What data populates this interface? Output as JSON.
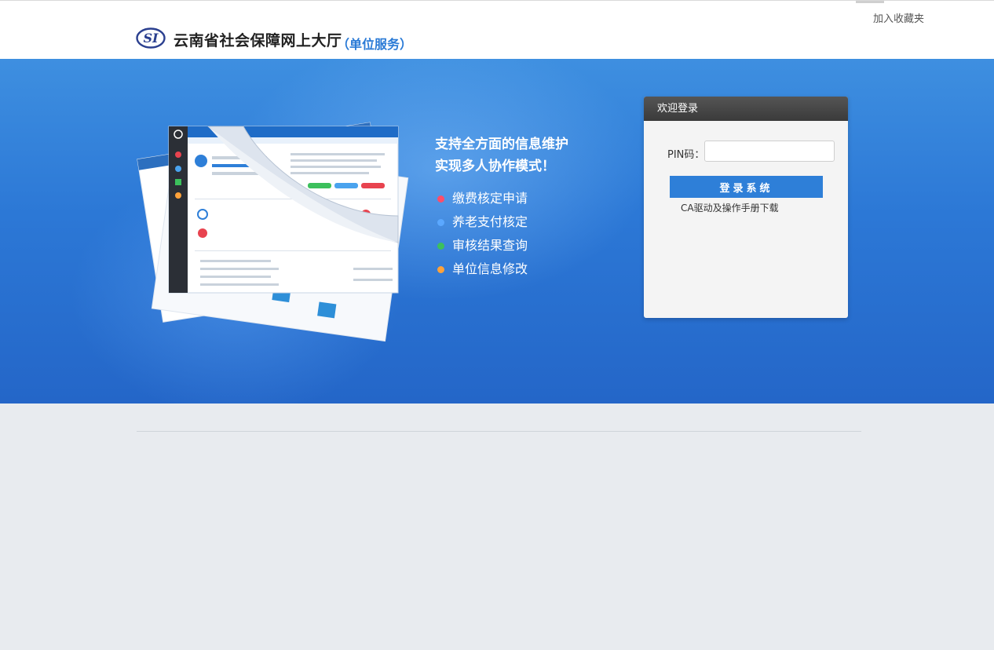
{
  "header": {
    "favorite": "加入收藏夹",
    "title": "云南省社会保障网上大厅",
    "subtitle": "（单位服务）",
    "logo_icon": "si-logo-icon"
  },
  "banner": {
    "slogan_line1": "支持全方面的信息维护",
    "slogan_line2": "实现多人协作模式！",
    "features": [
      {
        "label": "缴费核定申请",
        "color": "#ff4d6a"
      },
      {
        "label": "养老支付核定",
        "color": "#5ba8ff"
      },
      {
        "label": "审核结果查询",
        "color": "#3cc05c"
      },
      {
        "label": "单位信息修改",
        "color": "#ffa23a"
      }
    ]
  },
  "login": {
    "heading": "欢迎登录",
    "pin_label": "PIN码：",
    "pin_value": "",
    "submit": "登录系统",
    "ca_download": "CA驱动及操作手册下载"
  },
  "colors": {
    "accent": "#2e7fd8",
    "banner_blue": "#2c78d6"
  }
}
